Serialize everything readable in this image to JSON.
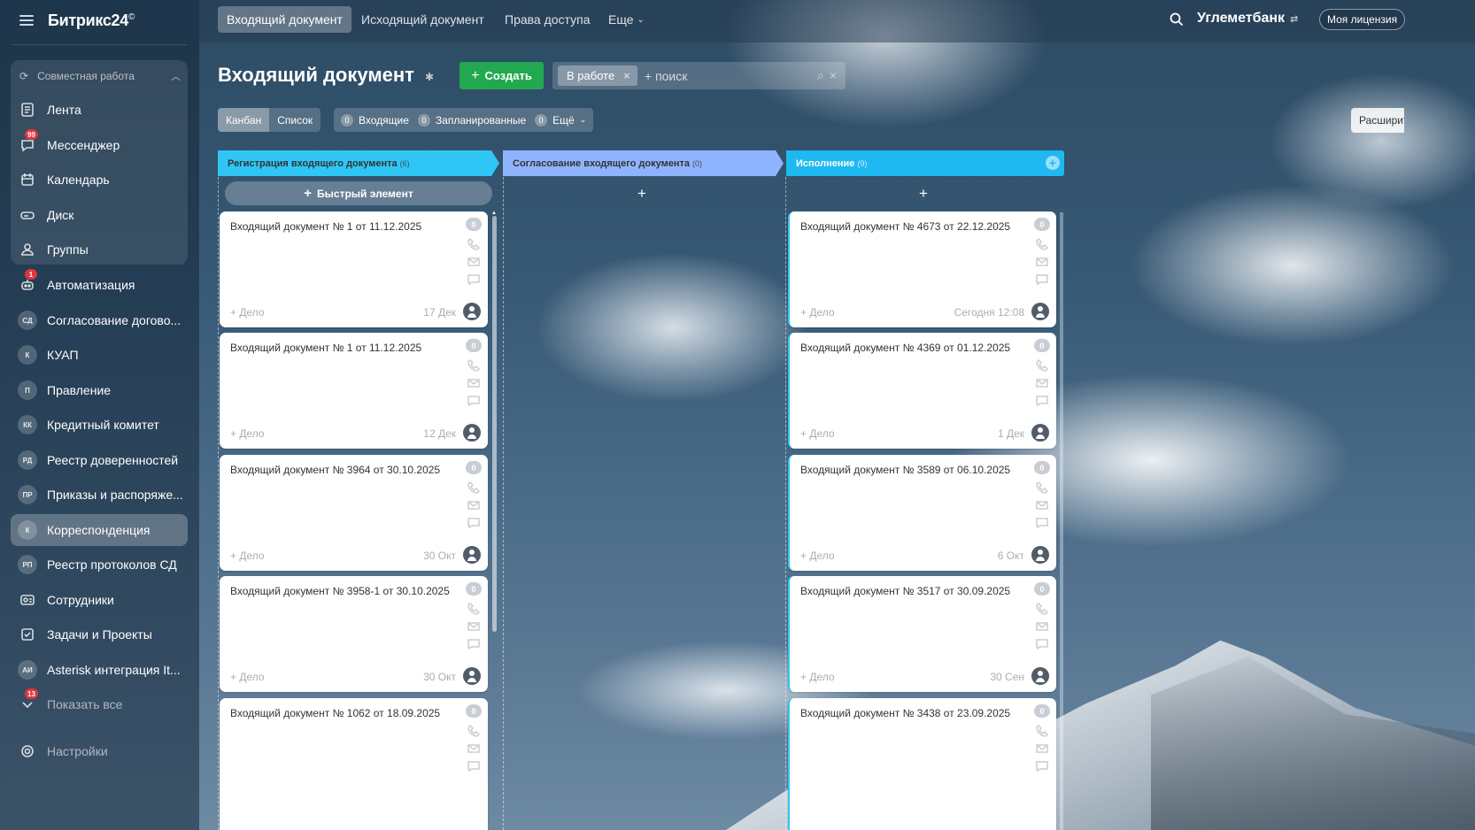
{
  "app": {
    "logo": "Битрикс24",
    "logo_mark": "©"
  },
  "sidebar": {
    "group_title": "Совместная работа",
    "items": [
      {
        "label": "Лента",
        "icon": "feed-icon"
      },
      {
        "label": "Мессенджер",
        "icon": "chat-icon",
        "badge": "99"
      },
      {
        "label": "Календарь",
        "icon": "calendar-icon"
      },
      {
        "label": "Диск",
        "icon": "disk-icon"
      },
      {
        "label": "Группы",
        "icon": "groups-icon"
      },
      {
        "label": "Автоматизация",
        "icon": "robot-icon",
        "badge": "1"
      },
      {
        "label": "Согласование догово...",
        "avatar": "СД"
      },
      {
        "label": "КУАП",
        "avatar": "К"
      },
      {
        "label": "Правление",
        "avatar": "П"
      },
      {
        "label": "Кредитный комитет",
        "avatar": "КК"
      },
      {
        "label": "Реестр доверенностей",
        "avatar": "РД"
      },
      {
        "label": "Приказы и распоряже...",
        "avatar": "ПР"
      },
      {
        "label": "Корреспонденция",
        "avatar": "К"
      },
      {
        "label": "Реестр протоколов СД",
        "avatar": "РП"
      },
      {
        "label": "Сотрудники",
        "icon": "employees-icon"
      },
      {
        "label": "Задачи и Проекты",
        "icon": "tasks-icon"
      },
      {
        "label": "Asterisk интеграция It...",
        "avatar": "АИ"
      },
      {
        "label": "Показать все",
        "icon": "chevron-down-icon",
        "badge": "13"
      },
      {
        "label": "Настройки",
        "icon": "gear-icon"
      }
    ]
  },
  "topbar": {
    "tabs": [
      "Входящий документ",
      "Исходящий документ",
      "Права доступа",
      "Еще"
    ],
    "company": "Углеметбанк",
    "license": "Моя лицензия"
  },
  "header": {
    "title": "Входящий документ",
    "create_label": "Создать",
    "filter_tag": "В работе",
    "search_placeholder": "+ поиск"
  },
  "view": {
    "kanban": "Канбан",
    "list": "Список",
    "counters": [
      {
        "num": "0",
        "label": "Входящие"
      },
      {
        "num": "0",
        "label": "Запланированные"
      },
      {
        "num": "0",
        "label": "Ещё"
      }
    ],
    "expand": "Расширить"
  },
  "colors": {
    "col1": "#2fc6f6",
    "col2": "#8fb4ff",
    "col3": "#1fb9f2",
    "create": "#22a94f"
  },
  "columns": [
    {
      "title": "Регистрация входящего документа",
      "count": "(6)",
      "quick_add": "Быстрый элемент",
      "cards": [
        {
          "title": "Входящий документ № 1 от 11.12.2025",
          "count": "0",
          "task": "+ Дело",
          "date": "17 Дек"
        },
        {
          "title": "Входящий документ № 1 от 11.12.2025",
          "count": "0",
          "task": "+ Дело",
          "date": "12 Дек"
        },
        {
          "title": "Входящий документ № 3964 от 30.10.2025",
          "count": "0",
          "task": "+ Дело",
          "date": "30 Окт"
        },
        {
          "title": "Входящий документ № 3958-1 от 30.10.2025",
          "count": "0",
          "task": "+ Дело",
          "date": "30 Окт"
        },
        {
          "title": "Входящий документ № 1062 от 18.09.2025",
          "count": "0",
          "task": "",
          "date": ""
        }
      ]
    },
    {
      "title": "Согласование входящего документа",
      "count": "(0)",
      "cards": []
    },
    {
      "title": "Исполнение",
      "count": "(9)",
      "cards": [
        {
          "title": "Входящий документ № 4673 от 22.12.2025",
          "count": "0",
          "task": "+ Дело",
          "date": "Сегодня 12:08"
        },
        {
          "title": "Входящий документ № 4369 от 01.12.2025",
          "count": "0",
          "task": "+ Дело",
          "date": "1 Дек"
        },
        {
          "title": "Входящий документ № 3589 от 06.10.2025",
          "count": "0",
          "task": "+ Дело",
          "date": "6 Окт"
        },
        {
          "title": "Входящий документ № 3517 от 30.09.2025",
          "count": "0",
          "task": "+ Дело",
          "date": "30 Сен"
        },
        {
          "title": "Входящий документ № 3438 от 23.09.2025",
          "count": "0",
          "task": "",
          "date": ""
        }
      ]
    }
  ]
}
